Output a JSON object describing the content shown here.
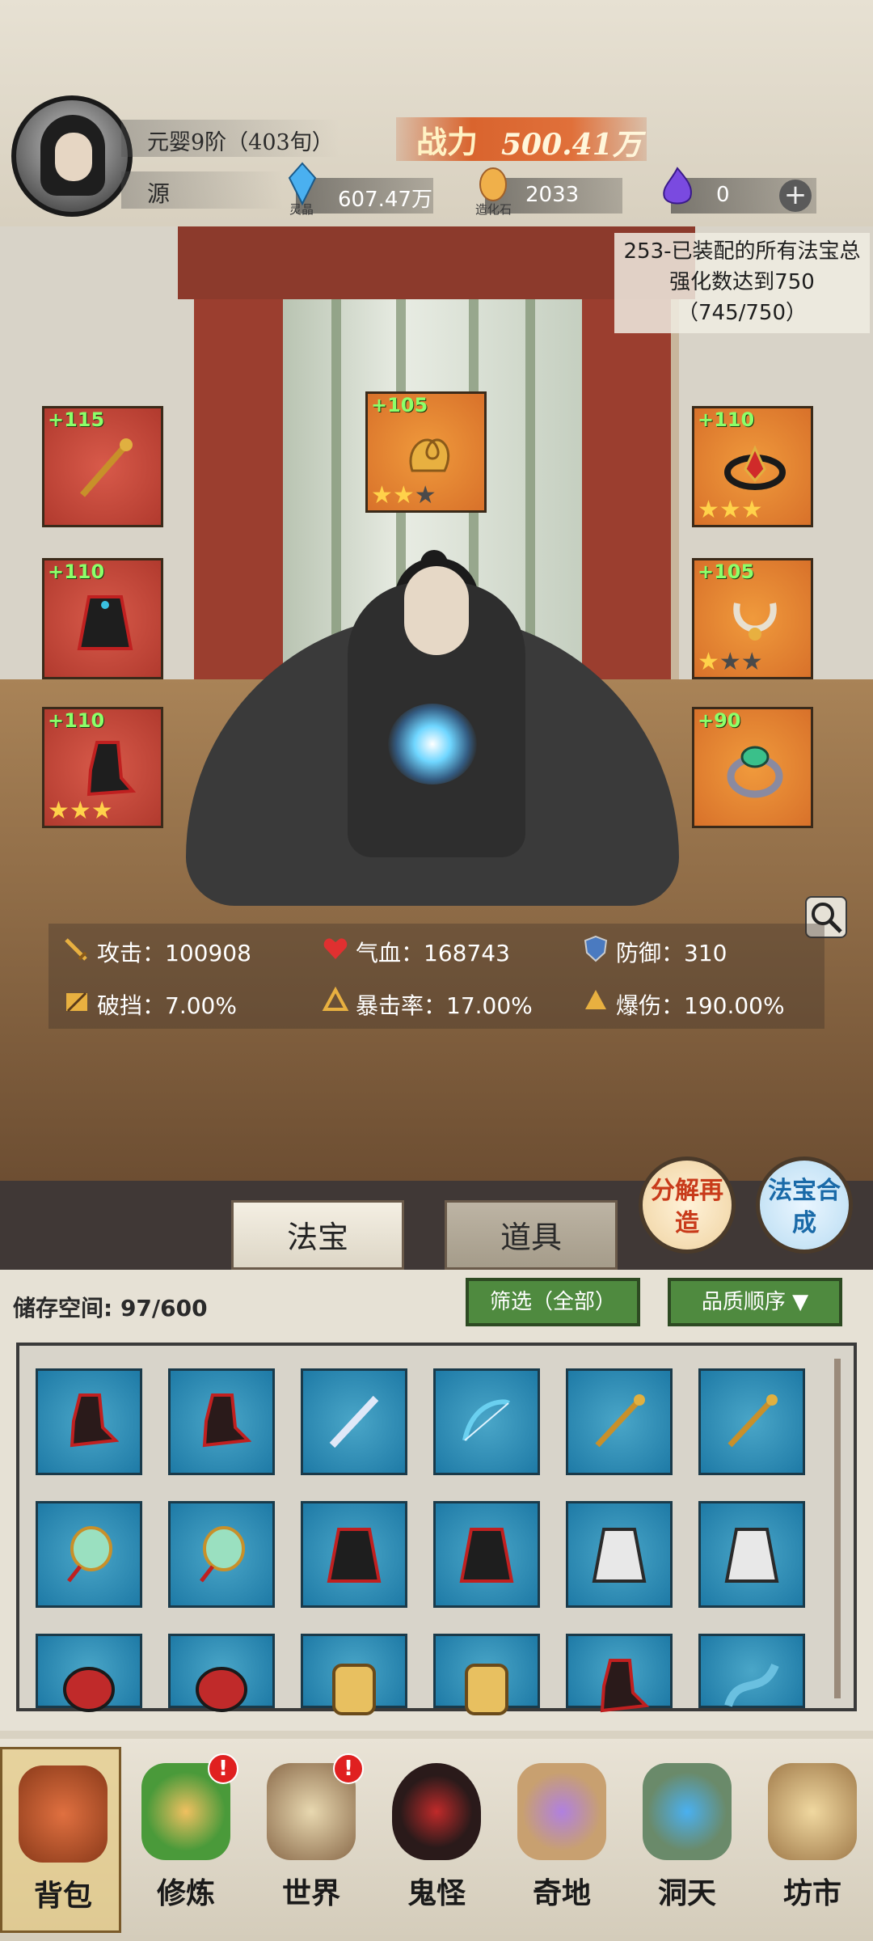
{
  "player": {
    "realm": "元婴9阶（403旬）",
    "sub_name": "源",
    "power_label": "战力",
    "power_value": "500.41万"
  },
  "resources": [
    {
      "name": "灵晶",
      "value": "607.47万",
      "icon": "crystal-icon",
      "color": "#3aa0e0"
    },
    {
      "name": "造化石",
      "value": "2033",
      "icon": "stone-icon",
      "color": "#e6a03a"
    },
    {
      "name": "",
      "value": "0",
      "icon": "soul-flame-icon",
      "color": "#7a4ae0"
    }
  ],
  "quest": {
    "text": "253-已装配的所有法宝总强化数达到750（745/750）"
  },
  "equipment": [
    {
      "slot": "weapon",
      "level": "+115",
      "stars": 0,
      "max_stars": 0,
      "bg": "red"
    },
    {
      "slot": "top-center",
      "level": "+105",
      "stars": 2,
      "max_stars": 3,
      "bg": "orange"
    },
    {
      "slot": "crown",
      "level": "+110",
      "stars": 3,
      "max_stars": 3,
      "bg": "orange"
    },
    {
      "slot": "robe",
      "level": "+110",
      "stars": 0,
      "max_stars": 0,
      "bg": "red"
    },
    {
      "slot": "necklace",
      "level": "+105",
      "stars": 1,
      "max_stars": 3,
      "bg": "orange"
    },
    {
      "slot": "boots",
      "level": "+110",
      "stars": 3,
      "max_stars": 3,
      "bg": "red"
    },
    {
      "slot": "ring",
      "level": "+90",
      "stars": 0,
      "max_stars": 0,
      "bg": "orange"
    }
  ],
  "stats": [
    {
      "label": "攻击：",
      "value": "100908",
      "icon": "sword-icon"
    },
    {
      "label": "气血：",
      "value": "168743",
      "icon": "heart-icon"
    },
    {
      "label": "防御：",
      "value": "310",
      "icon": "shield-icon"
    },
    {
      "label": "破挡：",
      "value": "7.00%",
      "icon": "break-icon"
    },
    {
      "label": "暴击率：",
      "value": "17.00%",
      "icon": "crit-icon"
    },
    {
      "label": "爆伤：",
      "value": "190.00%",
      "icon": "crit-damage-icon"
    }
  ],
  "actions": {
    "decompose": "分解再造",
    "synthesize": "法宝合成"
  },
  "tabs": [
    "法宝",
    "道具"
  ],
  "storage": {
    "label": "储存空间:",
    "value": "97/600",
    "filter": "筛选（全部）",
    "sort": "品质顺序"
  },
  "inventory": [
    {
      "item": "boots-red"
    },
    {
      "item": "boots-red"
    },
    {
      "item": "sword-silver"
    },
    {
      "item": "bow-blue"
    },
    {
      "item": "staff-gold"
    },
    {
      "item": "staff-gold"
    },
    {
      "item": "mirror-jade"
    },
    {
      "item": "mirror-jade"
    },
    {
      "item": "robe-red-black"
    },
    {
      "item": "robe-red-black"
    },
    {
      "item": "robe-white"
    },
    {
      "item": "robe-white"
    },
    {
      "item": "mask-red"
    },
    {
      "item": "mask-red"
    },
    {
      "item": "armor-gold"
    },
    {
      "item": "armor-gold"
    },
    {
      "item": "boots-red"
    },
    {
      "item": "dragon-blue"
    }
  ],
  "nav": [
    {
      "label": "背包",
      "badge": ""
    },
    {
      "label": "修炼",
      "badge": "!"
    },
    {
      "label": "世界",
      "badge": "!"
    },
    {
      "label": "鬼怪",
      "badge": ""
    },
    {
      "label": "奇地",
      "badge": ""
    },
    {
      "label": "洞天",
      "badge": ""
    },
    {
      "label": "坊市",
      "badge": ""
    }
  ]
}
